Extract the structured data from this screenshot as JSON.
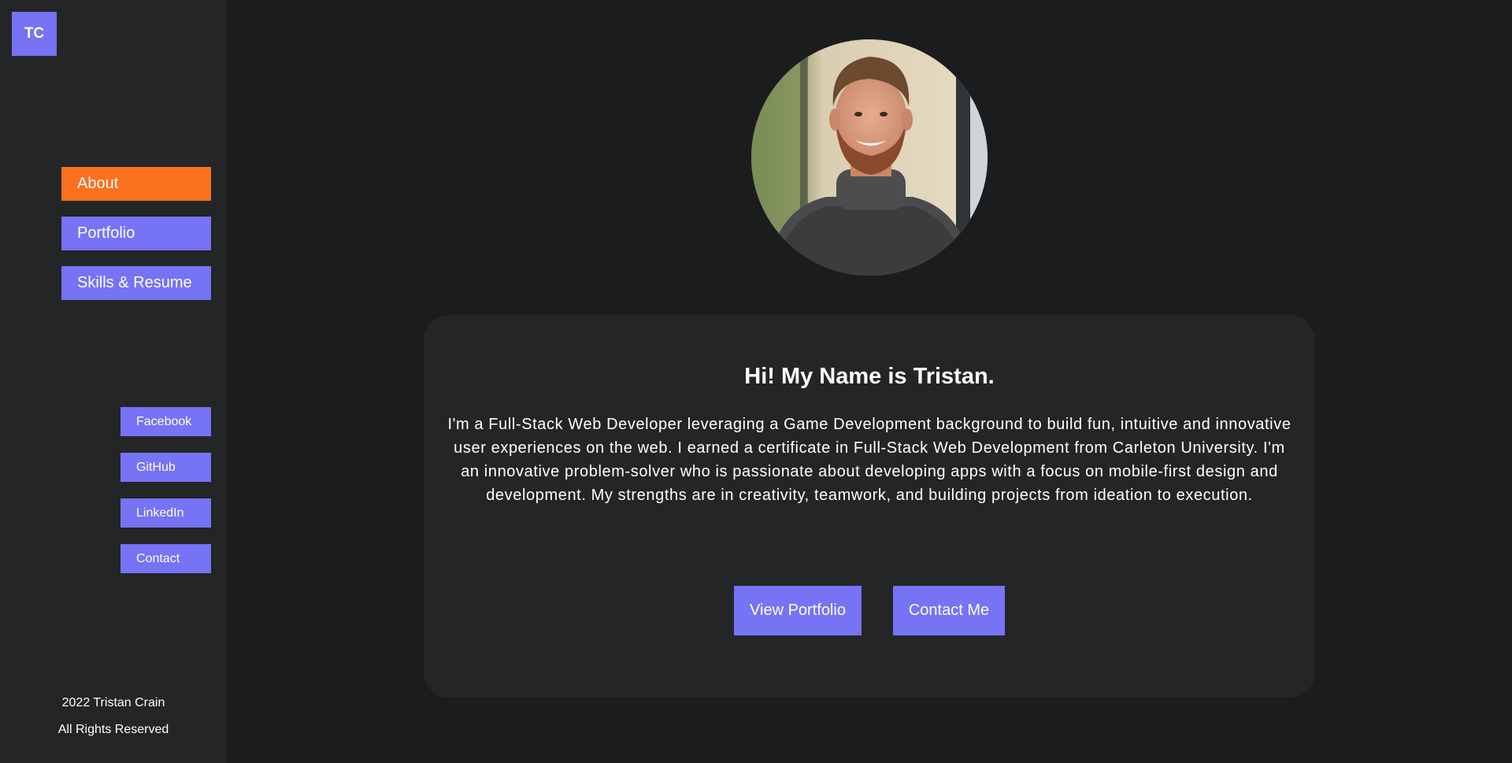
{
  "sidebar": {
    "logo": "TC",
    "nav": [
      {
        "label": "About",
        "active": true
      },
      {
        "label": "Portfolio",
        "active": false
      },
      {
        "label": "Skills & Resume",
        "active": false
      }
    ],
    "social": [
      {
        "label": "Facebook"
      },
      {
        "label": "GitHub"
      },
      {
        "label": "LinkedIn"
      },
      {
        "label": "Contact"
      }
    ],
    "footer": {
      "line1": "2022 Tristan Crain",
      "line2": "All Rights Reserved"
    }
  },
  "main": {
    "heading": "Hi! My Name is Tristan.",
    "bio": "I'm a Full-Stack Web Developer leveraging a Game Development background to build fun, intuitive and innovative user experiences on the web. I earned a certificate in Full-Stack Web Development from Carleton University. I'm an innovative problem-solver who is passionate about developing apps with a focus on mobile-first design and development. My strengths are in creativity, teamwork, and building projects from ideation to execution.",
    "buttons": {
      "portfolio": "View Portfolio",
      "contact": "Contact Me"
    }
  },
  "colors": {
    "accent": "#7673f5",
    "active": "#fb701f",
    "sidebar_bg": "#242527",
    "page_bg": "#1b1c1e"
  }
}
